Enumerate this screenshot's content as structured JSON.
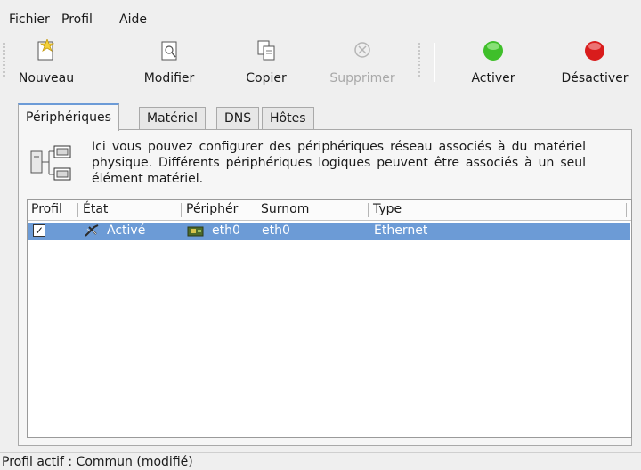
{
  "menubar": {
    "items": [
      "Fichier",
      "Profil",
      "Aide"
    ]
  },
  "toolbar": {
    "buttons": [
      {
        "label": "Nouveau",
        "icon": "new-document-icon",
        "enabled": true
      },
      {
        "label": "Modifier",
        "icon": "edit-document-icon",
        "enabled": true
      },
      {
        "label": "Copier",
        "icon": "copy-icon",
        "enabled": true
      },
      {
        "label": "Supprimer",
        "icon": "delete-icon",
        "enabled": false
      },
      {
        "label": "Activer",
        "icon": "green-circle-icon",
        "enabled": true
      },
      {
        "label": "Désactiver",
        "icon": "red-circle-icon",
        "enabled": true
      }
    ]
  },
  "tabs": {
    "items": [
      "Périphériques",
      "Matériel",
      "DNS",
      "Hôtes"
    ],
    "active": "Périphériques"
  },
  "info": {
    "text": "Ici vous pouvez configurer des périphériques réseau associés à du matériel physique. Différents périphériques logiques peuvent être associés à un seul élément matériel."
  },
  "table": {
    "columns": [
      "Profil",
      "État",
      "Périphér",
      "Surnom",
      "Type"
    ],
    "rows": [
      {
        "profil_checked": true,
        "etat": "Activé",
        "peripherique": "eth0",
        "surnom": "eth0",
        "type": "Ethernet",
        "selected": true
      }
    ]
  },
  "status": {
    "text": "Profil actif : Commun (modifié)"
  },
  "colors": {
    "selection": "#6c9bd6",
    "active_green": "#3fbf2a",
    "inactive_red": "#d91c1c"
  }
}
